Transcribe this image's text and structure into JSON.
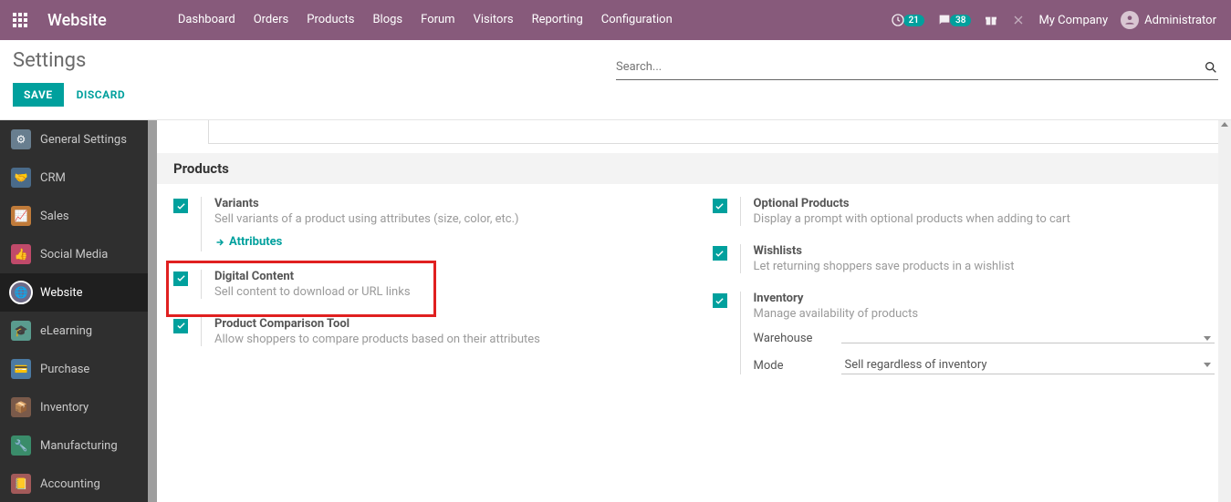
{
  "topbar": {
    "brand": "Website",
    "menu": [
      "Dashboard",
      "Orders",
      "Products",
      "Blogs",
      "Forum",
      "Visitors",
      "Reporting",
      "Configuration"
    ],
    "clock_badge": "21",
    "chat_badge": "38",
    "company": "My Company",
    "user": "Administrator"
  },
  "controlpanel": {
    "title": "Settings",
    "save": "SAVE",
    "discard": "DISCARD",
    "search_placeholder": "Search..."
  },
  "sidebar": {
    "items": [
      {
        "label": "General Settings"
      },
      {
        "label": "CRM"
      },
      {
        "label": "Sales"
      },
      {
        "label": "Social Media"
      },
      {
        "label": "Website"
      },
      {
        "label": "eLearning"
      },
      {
        "label": "Purchase"
      },
      {
        "label": "Inventory"
      },
      {
        "label": "Manufacturing"
      },
      {
        "label": "Accounting"
      }
    ]
  },
  "section": {
    "title": "Products"
  },
  "settings": {
    "variants": {
      "title": "Variants",
      "desc": "Sell variants of a product using attributes (size, color, etc.)",
      "link": "Attributes"
    },
    "digital": {
      "title": "Digital Content",
      "desc": "Sell content to download or URL links"
    },
    "comparison": {
      "title": "Product Comparison Tool",
      "desc": "Allow shoppers to compare products based on their attributes"
    },
    "optional": {
      "title": "Optional Products",
      "desc": "Display a prompt with optional products when adding to cart"
    },
    "wishlists": {
      "title": "Wishlists",
      "desc": "Let returning shoppers save products in a wishlist"
    },
    "inventory": {
      "title": "Inventory",
      "desc": "Manage availability of products",
      "warehouse_label": "Warehouse",
      "warehouse_value": "",
      "mode_label": "Mode",
      "mode_value": "Sell regardless of inventory"
    }
  }
}
